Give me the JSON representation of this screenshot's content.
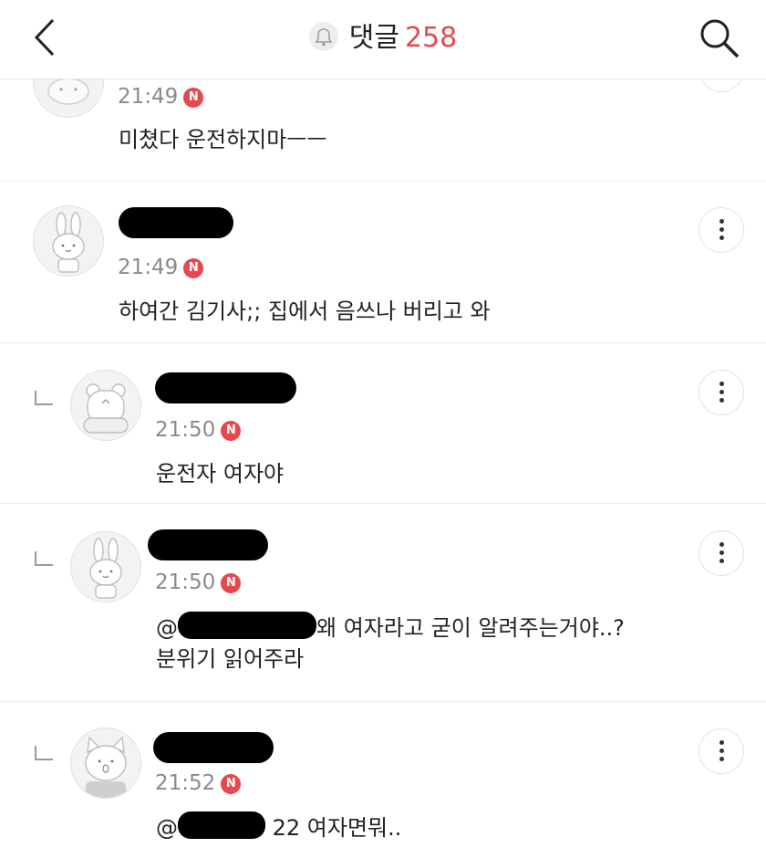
{
  "header": {
    "title": "댓글",
    "count": "258",
    "icons": {
      "back": "chevron-left-icon",
      "bell": "bell-icon",
      "search": "search-icon"
    }
  },
  "comments": [
    {
      "time": "21:49",
      "badge": "N",
      "text": "미쳤다 운전하지마ㅡㅡ"
    },
    {
      "time": "21:49",
      "badge": "N",
      "text": "하여간 김기사;; 집에서 음쓰나 버리고 와"
    },
    {
      "time": "21:50",
      "badge": "N",
      "text": "운전자 여자야"
    },
    {
      "time": "21:50",
      "badge": "N",
      "mention_prefix": "@",
      "text_line1": "왜 여자라고 굳이 알려주는거야..?",
      "text_line2": "분위기 읽어주라"
    },
    {
      "time": "21:52",
      "badge": "N",
      "mention_prefix": "@",
      "text": "22 여자면뭐.."
    }
  ],
  "colors": {
    "accent": "#e5484d",
    "meta": "#8a8a8a",
    "divider": "#ececec"
  }
}
